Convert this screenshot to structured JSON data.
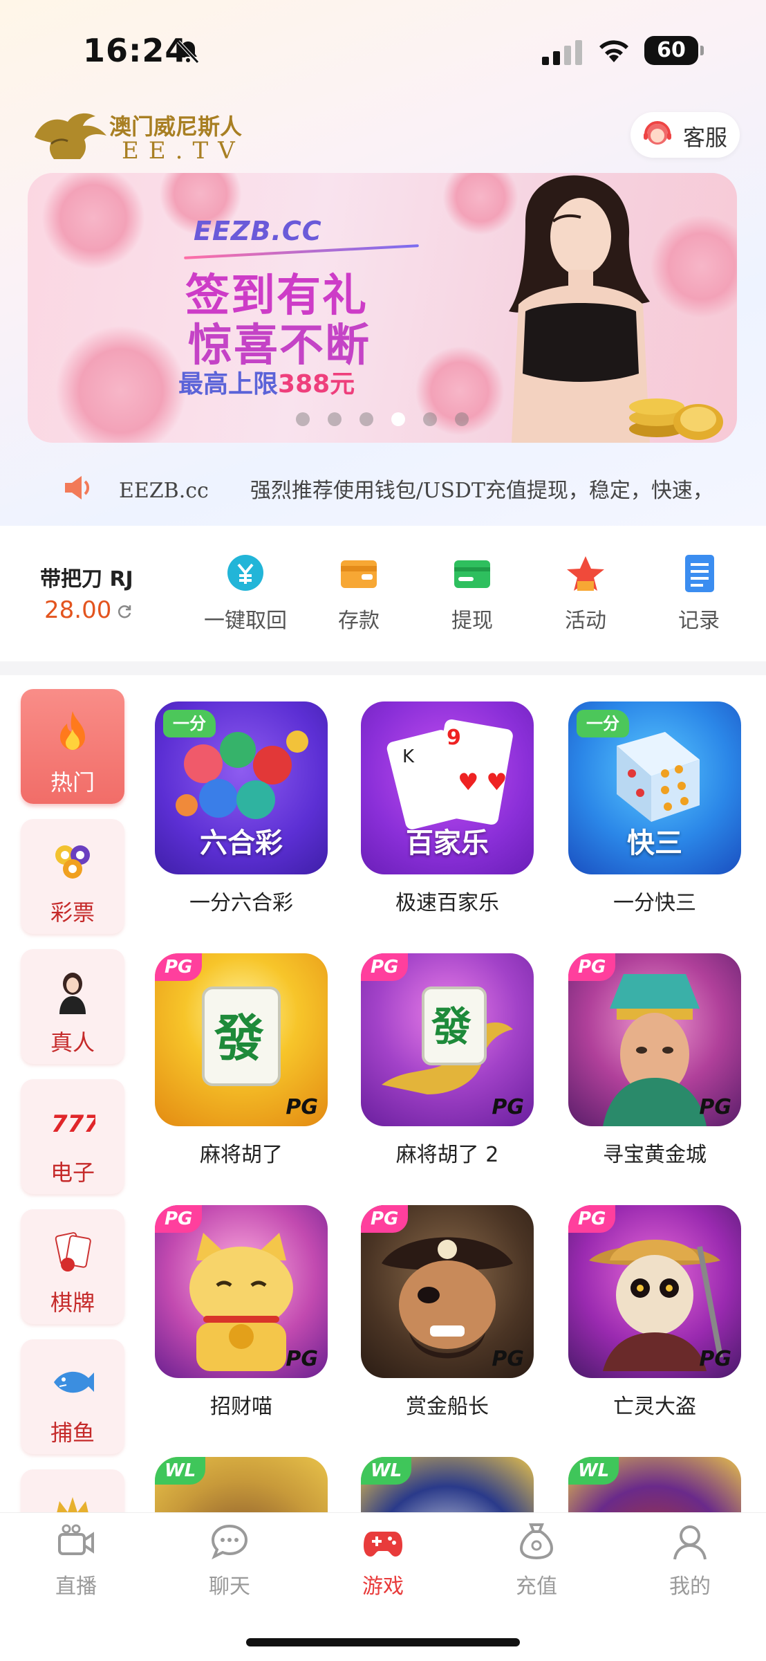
{
  "status": {
    "time": "16:24",
    "battery": "60"
  },
  "header": {
    "logo_cn": "澳门威尼斯人",
    "logo_en": "EE.TV",
    "service_label": "客服"
  },
  "banner": {
    "brand": "EEZB.CC",
    "line1": "签到有礼",
    "line2": "惊喜不断",
    "line3_prefix": "最高上限",
    "line3_amount": "388元",
    "dots": 6,
    "active_dot": 3
  },
  "marquee": {
    "text": "EEZB.cc　　强烈推荐使用钱包/USDT充值提现，稳定，快速，"
  },
  "account": {
    "user": "带把刀 RJ",
    "balance": "28.00",
    "actions": [
      {
        "label": "一键取回",
        "icon": "yuan-recall-icon"
      },
      {
        "label": "存款",
        "icon": "wallet-icon"
      },
      {
        "label": "提现",
        "icon": "card-icon"
      },
      {
        "label": "活动",
        "icon": "star-icon"
      },
      {
        "label": "记录",
        "icon": "document-icon"
      }
    ]
  },
  "sidebar": [
    {
      "label": "热门",
      "icon": "fire-icon",
      "active": true
    },
    {
      "label": "彩票",
      "icon": "lottery-balls-icon"
    },
    {
      "label": "真人",
      "icon": "live-dealer-icon"
    },
    {
      "label": "电子",
      "icon": "slot-777-icon"
    },
    {
      "label": "棋牌",
      "icon": "cards-icon"
    },
    {
      "label": "捕鱼",
      "icon": "fish-icon"
    },
    {
      "label": "",
      "icon": "crown-icon"
    }
  ],
  "games": [
    {
      "name": "一分六合彩",
      "tile_label": "六合彩",
      "badge": "一分",
      "badge_type": "fen"
    },
    {
      "name": "极速百家乐",
      "tile_label": "百家乐",
      "badge": "",
      "badge_type": ""
    },
    {
      "name": "一分快三",
      "tile_label": "快三",
      "badge": "一分",
      "badge_type": "fen"
    },
    {
      "name": "麻将胡了",
      "tile_label": "",
      "badge": "PG",
      "badge_type": "pg",
      "mark": "PG"
    },
    {
      "name": "麻将胡了 2",
      "tile_label": "",
      "badge": "PG",
      "badge_type": "pg",
      "mark": "PG"
    },
    {
      "name": "寻宝黄金城",
      "tile_label": "",
      "badge": "PG",
      "badge_type": "pg",
      "mark": "PG"
    },
    {
      "name": "招财喵",
      "tile_label": "",
      "badge": "PG",
      "badge_type": "pg",
      "mark": "PG"
    },
    {
      "name": "赏金船长",
      "tile_label": "",
      "badge": "PG",
      "badge_type": "pg",
      "mark": "PG"
    },
    {
      "name": "亡灵大盗",
      "tile_label": "",
      "badge": "PG",
      "badge_type": "pg",
      "mark": "PG"
    },
    {
      "name": "",
      "tile_label": "",
      "badge": "WL",
      "badge_type": "wl"
    },
    {
      "name": "",
      "tile_label": "",
      "badge": "WL",
      "badge_type": "wl"
    },
    {
      "name": "",
      "tile_label": "",
      "badge": "WL",
      "badge_type": "wl"
    }
  ],
  "nav": [
    {
      "label": "直播",
      "icon": "live-camera-icon"
    },
    {
      "label": "聊天",
      "icon": "chat-bubble-icon"
    },
    {
      "label": "游戏",
      "icon": "gamepad-icon",
      "active": true
    },
    {
      "label": "充值",
      "icon": "money-bag-icon"
    },
    {
      "label": "我的",
      "icon": "profile-icon"
    }
  ],
  "colors": {
    "accent": "#e83b3b",
    "balance": "#e3541e",
    "sidebar_active": "#f16d68",
    "gold": "#a87f23"
  }
}
